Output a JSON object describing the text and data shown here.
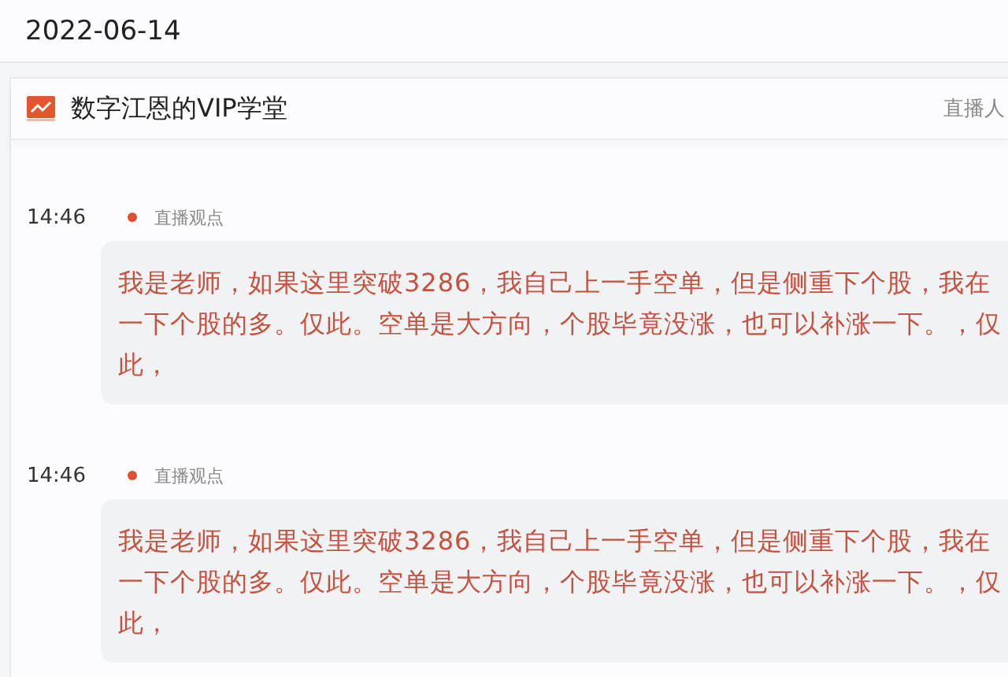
{
  "date_bar": {
    "date": "2022-06-14"
  },
  "channel": {
    "name": "数字江恩的VIP学堂",
    "host_label": "直播人"
  },
  "posts": [
    {
      "time": "14:46",
      "tag": "直播观点",
      "lines": [
        "我是老师，如果这里突破3286，我自己上一手空单，但是侧重下个股，我在",
        "一下个股的多。仅此。空单是大方向，个股毕竟没涨，也可以补涨一下。，仅",
        "此，"
      ]
    },
    {
      "time": "14:46",
      "tag": "直播观点",
      "lines": [
        "我是老师，如果这里突破3286，我自己上一手空单，但是侧重下个股，我在",
        "一下个股的多。仅此。空单是大方向，个股毕竟没涨，也可以补涨一下。，仅",
        "此，"
      ]
    }
  ]
}
